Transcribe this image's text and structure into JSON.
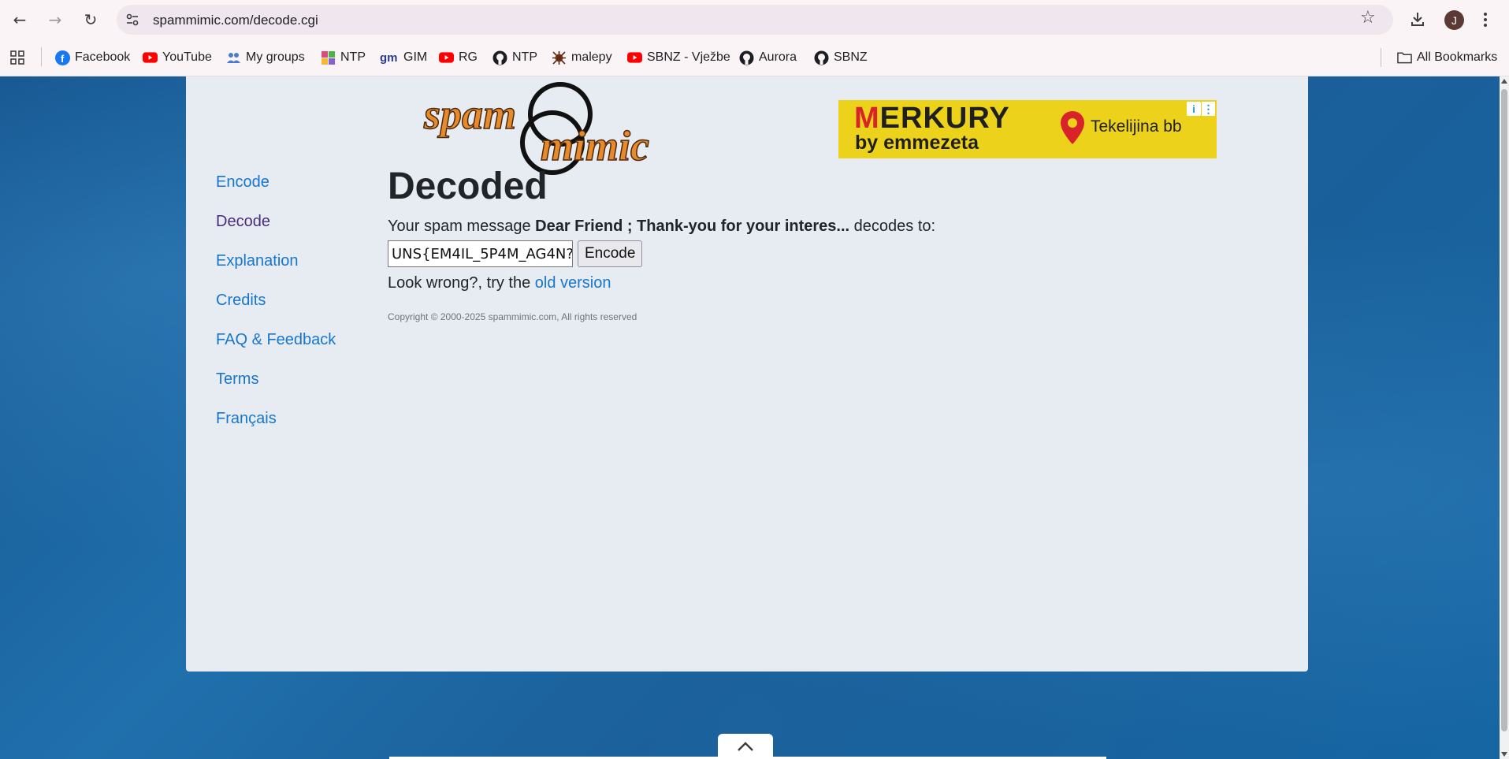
{
  "browser": {
    "url": "spammimic.com/decode.cgi",
    "profile_initial": "J",
    "bookmarks": [
      {
        "label": "Facebook",
        "icon": "facebook-icon"
      },
      {
        "label": "YouTube",
        "icon": "youtube-icon"
      },
      {
        "label": "My groups",
        "icon": "groups-icon"
      },
      {
        "label": "NTP",
        "icon": "puzzle-icon"
      },
      {
        "label": "GIM",
        "icon": "gm-icon"
      },
      {
        "label": "RG",
        "icon": "youtube-icon"
      },
      {
        "label": "NTP",
        "icon": "github-icon"
      },
      {
        "label": "malepy",
        "icon": "malepy-icon"
      },
      {
        "label": "SBNZ - Vježbe",
        "icon": "youtube-icon"
      },
      {
        "label": "Aurora",
        "icon": "github-icon"
      },
      {
        "label": "SBNZ",
        "icon": "github-icon"
      }
    ],
    "all_bookmarks_label": "All Bookmarks"
  },
  "ad": {
    "brand_first": "M",
    "brand_rest": "ERKURY",
    "sub": "by emmezeta",
    "location": "Tekelijina bb"
  },
  "nav": {
    "items": [
      "Encode",
      "Decode",
      "Explanation",
      "Credits",
      "FAQ & Feedback",
      "Terms",
      "Français"
    ]
  },
  "main": {
    "heading": "Decoded",
    "msg_prefix": "Your spam message ",
    "msg_bold": "Dear Friend ; Thank-you for your interes...",
    "msg_suffix": " decodes to:",
    "decoded_value": "UNS{EM4IL_5P4M_AG4N?",
    "encode_button": "Encode",
    "retry_prefix": "Look wrong?, try the ",
    "retry_link": "old version",
    "copyright": "Copyright © 2000-2025 spammimic.com, All rights reserved"
  },
  "colors": {
    "link": "#1776cf",
    "visited_link": "#4a2c7e",
    "card_bg": "#e6ecf1",
    "logo_orange": "#e8892a",
    "ad_yellow": "#ecd21b"
  }
}
